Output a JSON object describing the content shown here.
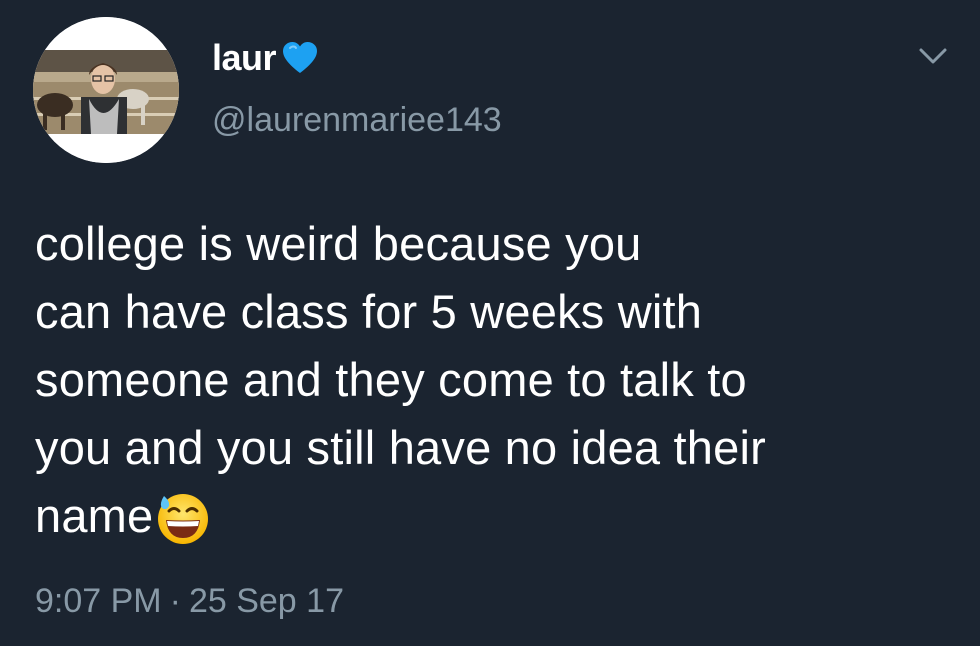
{
  "tweet": {
    "display_name": "laur",
    "name_emoji": "blue-heart-icon",
    "handle": "@laurenmariee143",
    "text_lines": [
      "college is weird because you",
      "can have class for 5 weeks with",
      "someone and they come to talk to",
      "you and you still have no idea their",
      "name"
    ],
    "text_emoji": "grinning-sweat-icon",
    "time": "9:07 PM",
    "separator": "·",
    "date": "25 Sep 17"
  },
  "colors": {
    "background": "#1b2430",
    "text": "#ffffff",
    "secondary_text": "#8899a6",
    "heart": "#1da1f2"
  }
}
